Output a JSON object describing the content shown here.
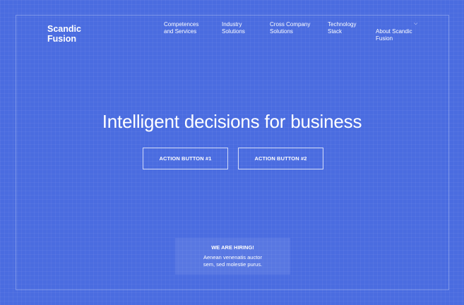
{
  "brand": {
    "name": "Scandic\nFusion"
  },
  "nav": {
    "items": [
      {
        "label": "Competences\nand Services"
      },
      {
        "label": "Industry\nSolutions"
      },
      {
        "label": "Cross Company\nSolutions"
      },
      {
        "label": "Technology\nStack"
      },
      {
        "label": "About Scandic\nFusion",
        "icon": "chevron-down-icon"
      }
    ]
  },
  "hero": {
    "title": "Intelligent decisions for business"
  },
  "actions": {
    "button1": "ACTION BUTTON #1",
    "button2": "ACTION BUTTON #2"
  },
  "hiring": {
    "title": "WE ARE HIRING!",
    "text": "Aenean venenatis auctor\nsem, sed molestie purus."
  },
  "colors": {
    "background": "#4a6ce0",
    "text": "#ffffff"
  }
}
